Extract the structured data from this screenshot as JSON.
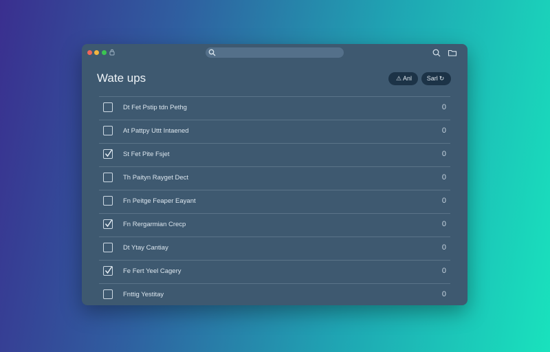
{
  "window": {
    "title": "Wate ups",
    "search": {
      "value": "",
      "placeholder": ""
    }
  },
  "icons": {
    "titlebar_extra": "lock-icon",
    "search": "search-icon",
    "right_search": "search-icon",
    "right_folder": "folder-icon"
  },
  "toolbar": {
    "button_one_label": "Anl",
    "button_two_label": "Sarl"
  },
  "items": [
    {
      "label": "Dt Fet Pstip tdn Pethg",
      "checked": false,
      "count": "0"
    },
    {
      "label": "At Pattpy Uttt Intaened",
      "checked": false,
      "count": "0"
    },
    {
      "label": "St Fet Pite Fsjet",
      "checked": true,
      "count": "0"
    },
    {
      "label": "Th Paityn Rayget Dect",
      "checked": false,
      "count": "0"
    },
    {
      "label": "Fn Peitge Feaper Eayant",
      "checked": false,
      "count": "0"
    },
    {
      "label": "Fn Rergarmian Crecp",
      "checked": true,
      "count": "0"
    },
    {
      "label": "Dt Ytay Cantiay",
      "checked": false,
      "count": "0"
    },
    {
      "label": "Fe Fert Yeel Cagery",
      "checked": true,
      "count": "0"
    },
    {
      "label": "Fnttig Yestitay",
      "checked": false,
      "count": "0"
    }
  ],
  "colors": {
    "window_bg": "#3e5970",
    "button_bg": "#1c3347",
    "divider": "#5b7489",
    "text": "#dce6ee"
  }
}
